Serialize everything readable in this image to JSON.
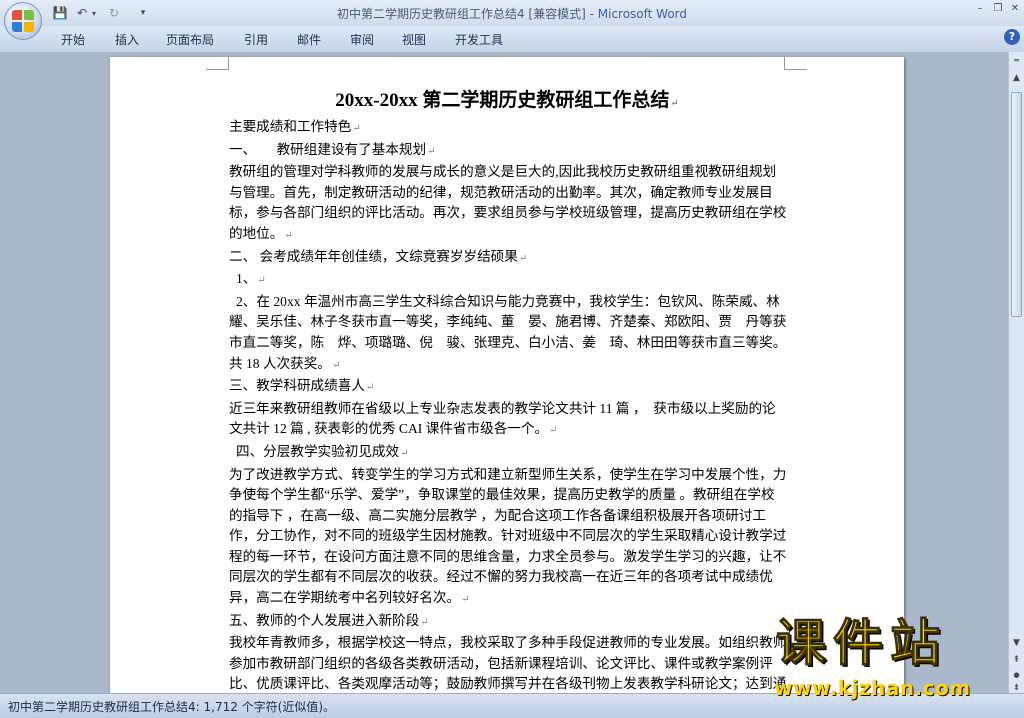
{
  "window": {
    "title": "初中第二学期历史教研组工作总结4 [兼容模式] - ",
    "app_name": "Microsoft Word",
    "minimize": "–",
    "restore": "❐",
    "close": "✕"
  },
  "quick_access": {
    "save": "💾",
    "undo": "↶",
    "redo": "↻",
    "customize": "▾"
  },
  "ribbon": {
    "tabs": [
      "开始",
      "插入",
      "页面布局",
      "引用",
      "邮件",
      "审阅",
      "视图",
      "开发工具"
    ],
    "help": "?"
  },
  "document": {
    "title": "20xx-20xx 第二学期历史教研组工作总结",
    "paragraph_mark": "↵",
    "paragraphs": [
      "主要成绩和工作特色",
      "一、　　教研组建设有了基本规划",
      "教研组的管理对学科教师的发展与成长的意义是巨大的,因此我校历史教研组重视教研组规划与管理。首先，制定教研活动的纪律，规范教研活动的出勤率。其次，确定教师专业发展目标，参与各部门组织的评比活动。再次，要求组员参与学校班级管理，提高历史教研组在学校的地位。",
      "二、 会考成绩年年创佳绩，文综竞赛岁岁结硕果",
      "1、",
      "2、在 20xx 年温州市高三学生文科综合知识与能力竞赛中，我校学生：包钦风、陈荣威、林　耀、吴乐佳、林子冬获市直一等奖，李纯纯、董　晏、施君博、齐楚秦、郑欧阳、贾　丹等获市直二等奖，陈　烨、项璐璐、倪　骏、张理克、白小洁、姜　琦、林田田等获市直三等奖。共 18 人次获奖。",
      "三、教学科研成绩喜人",
      "近三年来教研组教师在省级以上专业杂志发表的教学论文共计 11 篇 ，　获市级以上奖励的论文共计 12 篇 , 获表彰的优秀 CAI 课件省市级各一个。",
      "四、分层教学实验初见成效",
      "为了改进教学方式、转变学生的学习方式和建立新型师生关系，使学生在学习中发展个性，力争使每个学生都“乐学、爱学”，争取课堂的最佳效果，提高历史教学的质量 。教研组在学校的指导下 ，在高一级、高二实施分层教学 ，为配合这项工作各备课组积极展开各项研讨工作，分工协作，对不同的班级学生因材施教。针对班级中不同层次的学生采取精心设计教学过程的每一环节，在设问方面注意不同的思维含量，力求全员参与。激发学生学习的兴趣，让不同层次的学生都有不同层次的收获。经过不懈的努力我校高一在近三年的各项考试中成绩优异，高二在学期统考中名列较好名次。",
      "五、教师的个人发展进入新阶段",
      "我校年青教师多，根据学校这一特点，我校采取了多种手段促进教师的专业发展。如组织教师参加市教研部门组织的各级各类教研活动，包括新课程培训、论文评比、课件或教学案例评比、优质课评比、各类观摩活动等；鼓励教师撰写并在各级刊物上发表教学科研论文；达到通过各种有效途径开阔视野和展示教学成果的目的。在学校的指导下，在中年教师中肯的"
    ]
  },
  "status": {
    "text": "初中第二学期历史教研组工作总结4: 1,712 个字符(近似值)。"
  },
  "scrollbar": {
    "up": "▲",
    "down": "▼",
    "prev_page": "⇞",
    "select_browse": "●",
    "next_page": "⇟"
  },
  "watermark": {
    "big": "课件站",
    "url": "www.kjzhan.com"
  },
  "colors": {
    "app_name": "#3b5ea8",
    "watermark": "#ffd400"
  }
}
